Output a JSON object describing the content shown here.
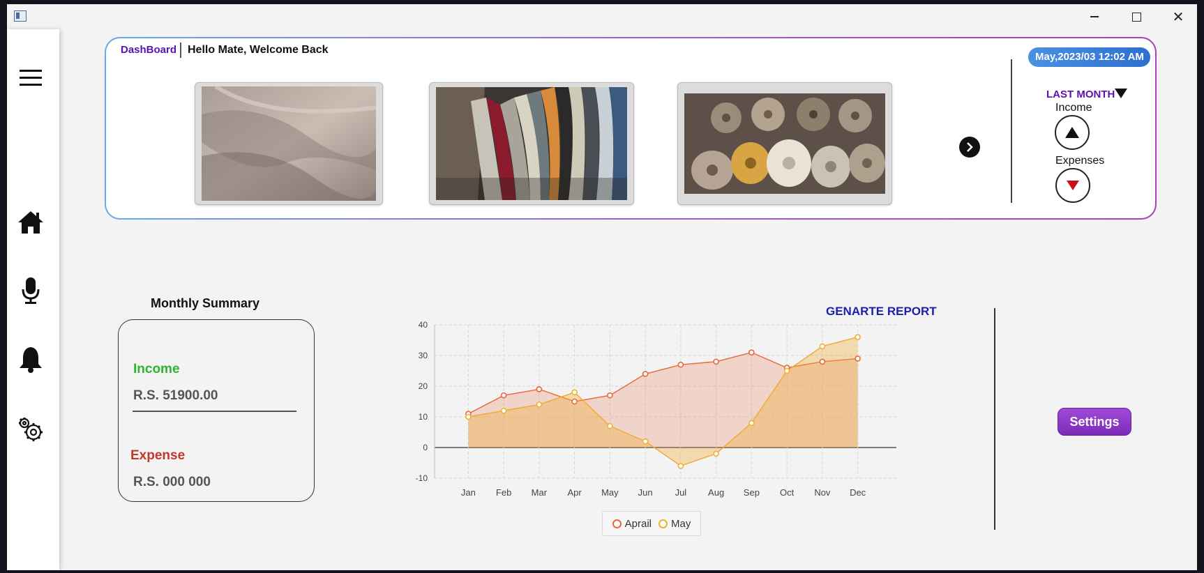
{
  "window": {
    "controls": {
      "minimize": "minimize",
      "maximize": "maximize",
      "close": "✕"
    }
  },
  "sidebar": {
    "items": [
      {
        "icon": "hamburger-menu-icon"
      },
      {
        "icon": "home-icon"
      },
      {
        "icon": "microphone-icon"
      },
      {
        "icon": "bell-icon"
      },
      {
        "icon": "gear-icon"
      }
    ]
  },
  "header": {
    "tab_label": "DashBoard",
    "welcome": "Hello Mate, Welcome Back",
    "datetime": "May,2023/03  12:02 AM",
    "period": "LAST MONTH",
    "income_label": "Income",
    "expenses_label": "Expenses"
  },
  "carousel": {
    "images": [
      "folded-fabric-image",
      "stacked-fabrics-image",
      "fabric-rolls-image"
    ]
  },
  "summary": {
    "title": "Monthly Summary",
    "income_label": "Income",
    "income_value": "R.S. 51900.00",
    "expense_label": "Expense",
    "expense_value": "R.S. 000 000"
  },
  "actions": {
    "report_label": "GENARTE REPORT",
    "settings_label": "Settings"
  },
  "colors": {
    "accent_purple": "#5a12b0",
    "income_green": "#2fb52f",
    "expense_red": "#c0392b",
    "report_blue": "#1d1db0",
    "series_aprail": "#e8683a",
    "series_may": "#f0a830"
  },
  "chart_data": {
    "type": "area",
    "categories": [
      "Jan",
      "Feb",
      "Mar",
      "Apr",
      "May",
      "Jun",
      "Jul",
      "Aug",
      "Sep",
      "Oct",
      "Nov",
      "Dec"
    ],
    "series": [
      {
        "name": "Aprail",
        "values": [
          11,
          17,
          19,
          15,
          17,
          24,
          27,
          28,
          31,
          26,
          28,
          29
        ]
      },
      {
        "name": "May",
        "values": [
          10,
          12,
          14,
          18,
          7,
          2,
          -6,
          -2,
          8,
          25,
          33,
          36
        ]
      }
    ],
    "ylim": [
      -10,
      40
    ],
    "yticks": [
      -10,
      0,
      10,
      20,
      30,
      40
    ],
    "grid": true,
    "legend": "bottom"
  }
}
